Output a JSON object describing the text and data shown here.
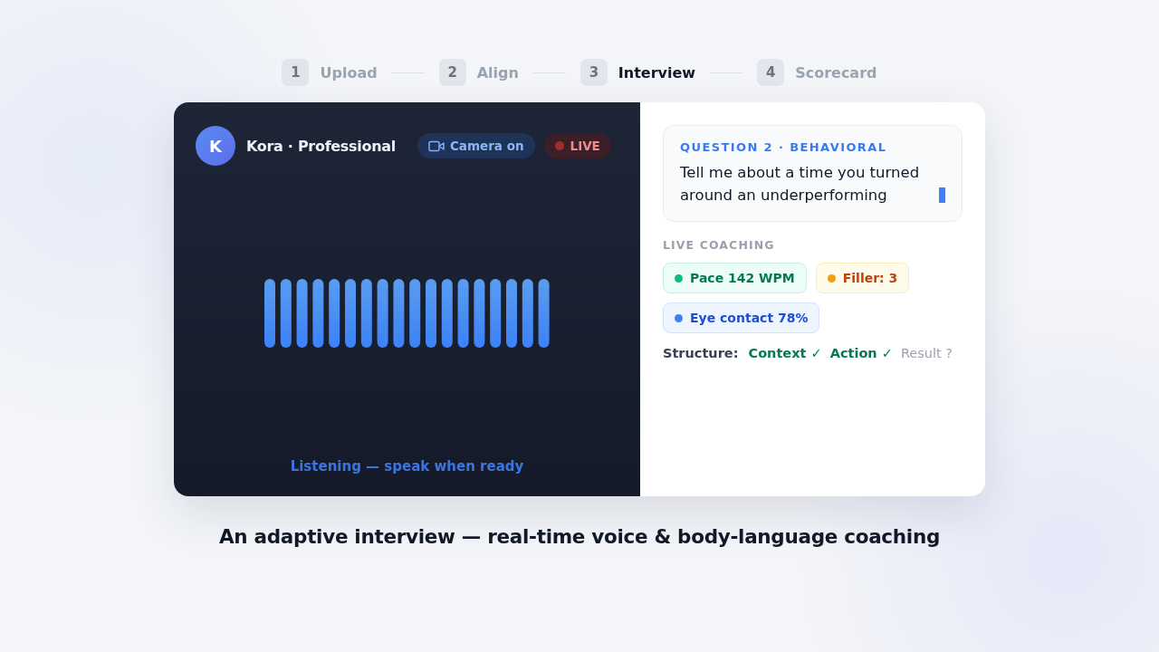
{
  "steps": [
    {
      "number": "1",
      "label": "Upload",
      "selected": false
    },
    {
      "number": "2",
      "label": "Align",
      "selected": false
    },
    {
      "number": "3",
      "label": "Interview",
      "selected": true
    },
    {
      "number": "4",
      "label": "Scorecard",
      "selected": false
    }
  ],
  "video_panel": {
    "avatar_letter": "K",
    "interviewer": "Kora · Professional",
    "camera_badge": "Camera on",
    "live_badge": "LIVE",
    "status": "Listening — speak when ready"
  },
  "question_card": {
    "heading": "QUESTION 2 · BEHAVIORAL",
    "text": "Tell me about a time you turned around an underperforming"
  },
  "coaching": {
    "heading": "LIVE COACHING",
    "chips": [
      {
        "label": "Pace 142 WPM",
        "color": "#10b981"
      },
      {
        "label": "Filler: 3",
        "color": "#f59e0b"
      },
      {
        "label": "Eye contact 78%",
        "color": "#3b82f6"
      }
    ],
    "structure_label": "Structure:",
    "structure": [
      {
        "label": "Context ✓",
        "done": true
      },
      {
        "label": "Action ✓",
        "done": true
      },
      {
        "label": "Result ?",
        "done": false
      }
    ]
  },
  "caption": "An adaptive interview — real-time voice & body-language coaching"
}
